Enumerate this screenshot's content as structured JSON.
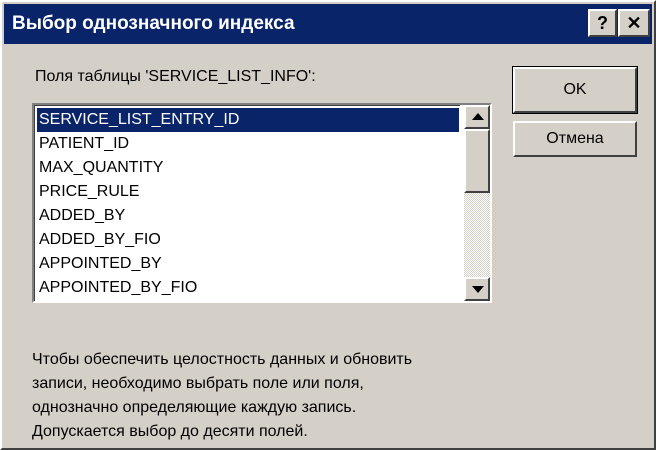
{
  "window": {
    "title": "Выбор однозначного индекса",
    "help_label": "?",
    "close_label": "✕"
  },
  "fields_label": "Поля таблицы 'SERVICE_LIST_INFO':",
  "fields": [
    "SERVICE_LIST_ENTRY_ID",
    "PATIENT_ID",
    "MAX_QUANTITY",
    "PRICE_RULE",
    "ADDED_BY",
    "ADDED_BY_FIO",
    "APPOINTED_BY",
    "APPOINTED_BY_FIO"
  ],
  "selected_field": "SERVICE_LIST_ENTRY_ID",
  "buttons": {
    "ok": "OK",
    "cancel": "Отмена"
  },
  "info_lines": [
    "Чтобы обеспечить целостность данных и обновить",
    "записи, необходимо выбрать поле или поля,",
    "однозначно определяющие каждую запись.",
    "Допускается выбор до десяти полей."
  ],
  "colors": {
    "titlebar": "#0a246a",
    "face": "#d4d0c8",
    "selection": "#0a246a"
  }
}
